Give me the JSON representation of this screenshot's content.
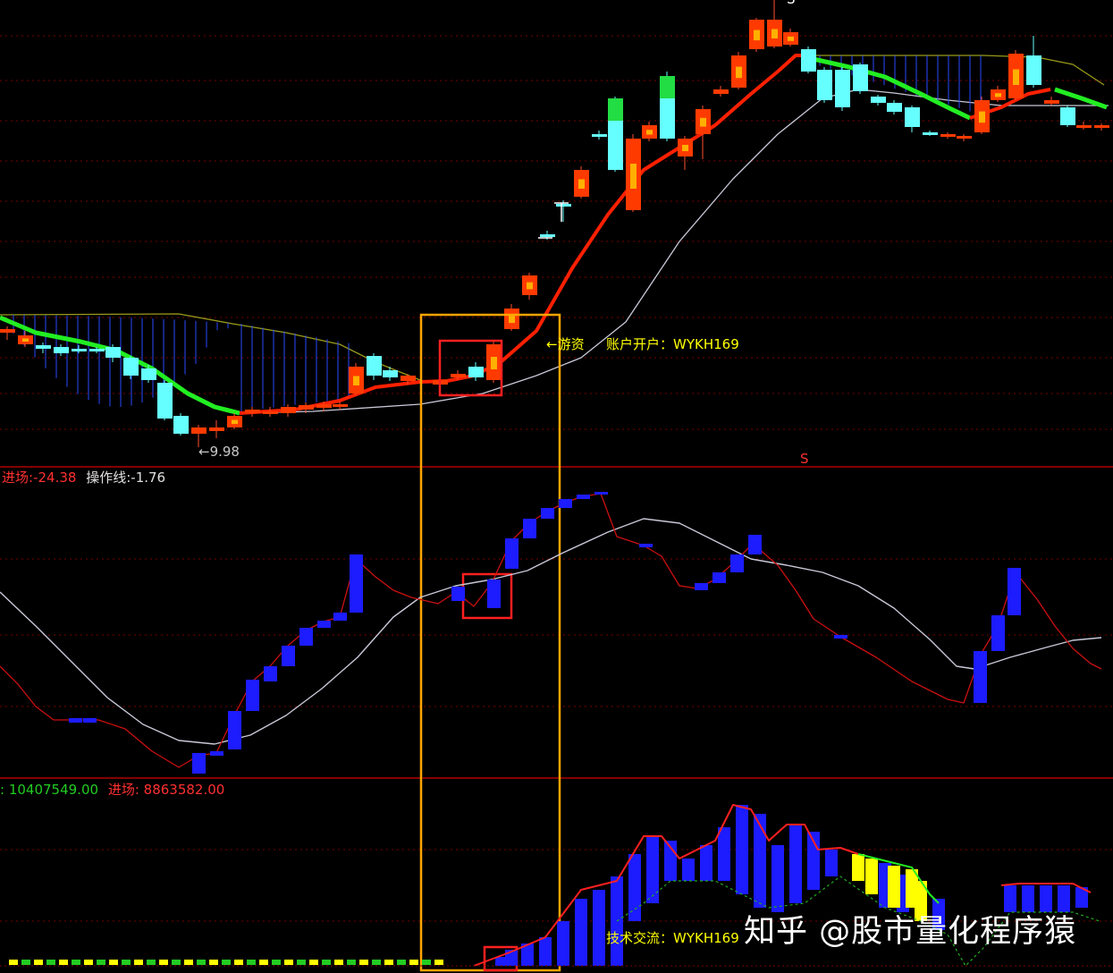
{
  "price_panel": {
    "low_marker": "←9.98",
    "annotation": "←游资",
    "account_label": "账户开户：WYKH169",
    "top_marker": "S",
    "bottom_marker": "S"
  },
  "osc_panel": {
    "entry_label": "进场",
    "entry_value": ":-24.38",
    "op_label": "操作线",
    "op_value": ":-1.76"
  },
  "volume_panel": {
    "first_label": "",
    "first_value": ": 10407549.00",
    "entry_label": "进场",
    "entry_value": ": 8863582.00",
    "tech_label": "技术交流：WYKH169"
  },
  "watermark": "知乎 @股市量化程序猿",
  "colors": {
    "background": "#000000",
    "up_candle": "#ff2a00",
    "down_candle": "#54ffff",
    "ma_fast_up": "#ff2000",
    "ma_fast_down": "#22ee22",
    "ma_slow": "#c8c8d8",
    "bars": "#1c1cff",
    "yellow_bars": "#ffff00",
    "highlight_box": "#ffa500",
    "red_box": "#ff2020"
  }
}
